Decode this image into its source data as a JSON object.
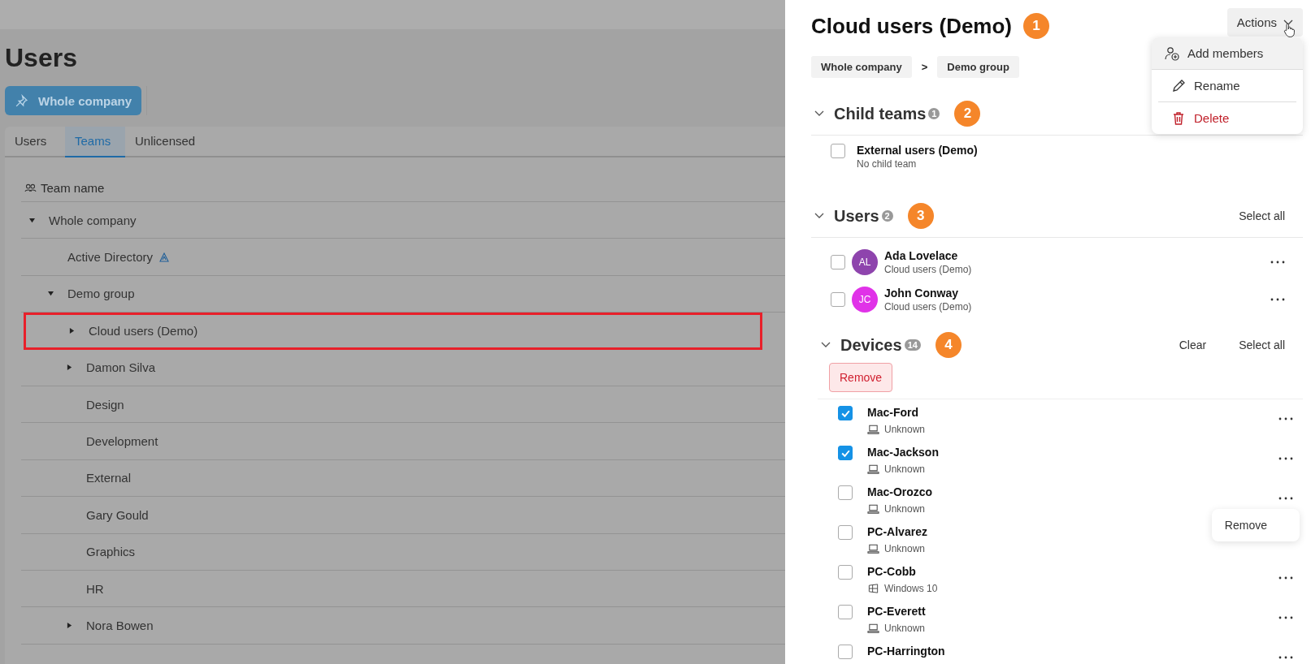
{
  "page": {
    "title": "Users",
    "scope_button": "Whole company"
  },
  "tabs": [
    {
      "label": "Users",
      "selected": false
    },
    {
      "label": "Teams",
      "selected": true
    },
    {
      "label": "Unlicensed",
      "selected": false
    }
  ],
  "team_table": {
    "column": "Team name",
    "rows": [
      {
        "name": "Whole company",
        "expanded": true,
        "highlighted": false,
        "children": [
          {
            "name": "Active Directory",
            "directory": true,
            "highlighted": false
          },
          {
            "name": "Demo group",
            "expanded": true,
            "highlighted": false,
            "children": [
              {
                "name": "Cloud users (Demo)",
                "expanded": false,
                "highlighted": true
              },
              {
                "name": "Damon Silva",
                "expanded": false,
                "highlighted": false
              },
              {
                "name": "Design",
                "highlighted": false
              },
              {
                "name": "Development",
                "highlighted": false
              },
              {
                "name": "External",
                "highlighted": false
              },
              {
                "name": "Gary Gould",
                "highlighted": false
              },
              {
                "name": "Graphics",
                "highlighted": false
              },
              {
                "name": "HR",
                "highlighted": false
              },
              {
                "name": "Nora Bowen",
                "expanded": false,
                "highlighted": false
              }
            ]
          }
        ]
      }
    ]
  },
  "panel": {
    "title": "Cloud users (Demo)",
    "callout": "1",
    "actions_button": "Actions",
    "actions_menu": [
      {
        "label": "Add members",
        "kind": "add"
      },
      {
        "label": "Rename",
        "kind": "rename"
      },
      {
        "label": "Delete",
        "kind": "delete"
      }
    ],
    "breadcrumbs": [
      "Whole company",
      "Demo group"
    ],
    "breadcrumb_separator": ">",
    "child_teams": {
      "title": "Child teams",
      "count": "1",
      "callout": "2",
      "expanded": true,
      "items": [
        {
          "name": "External users (Demo)",
          "detail": "No child team",
          "checked": false
        }
      ]
    },
    "users": {
      "title": "Users",
      "count": "2",
      "callout": "3",
      "expanded": true,
      "select_all": "Select all",
      "items": [
        {
          "initials": "AL",
          "name": "Ada Lovelace",
          "team": "Cloud users (Demo)",
          "color": "#8e44ad",
          "checked": false
        },
        {
          "initials": "JC",
          "name": "John Conway",
          "team": "Cloud users (Demo)",
          "color": "#e032e8",
          "checked": false
        }
      ]
    },
    "devices": {
      "title": "Devices",
      "count": "14",
      "callout": "4",
      "expanded": true,
      "clear": "Clear",
      "select_all": "Select all",
      "remove_button": "Remove",
      "items": [
        {
          "name": "Mac-Ford",
          "os": "Unknown",
          "kind": "laptop",
          "checked": true
        },
        {
          "name": "Mac-Jackson",
          "os": "Unknown",
          "kind": "laptop",
          "checked": true
        },
        {
          "name": "Mac-Orozco",
          "os": "Unknown",
          "kind": "laptop",
          "checked": false
        },
        {
          "name": "PC-Alvarez",
          "os": "Unknown",
          "kind": "laptop",
          "checked": false
        },
        {
          "name": "PC-Cobb",
          "os": "Windows 10",
          "kind": "windows",
          "checked": false
        },
        {
          "name": "PC-Everett",
          "os": "Unknown",
          "kind": "laptop",
          "checked": false
        },
        {
          "name": "PC-Harrington",
          "checked": false
        }
      ]
    },
    "row_menu": {
      "label": "Remove"
    }
  }
}
